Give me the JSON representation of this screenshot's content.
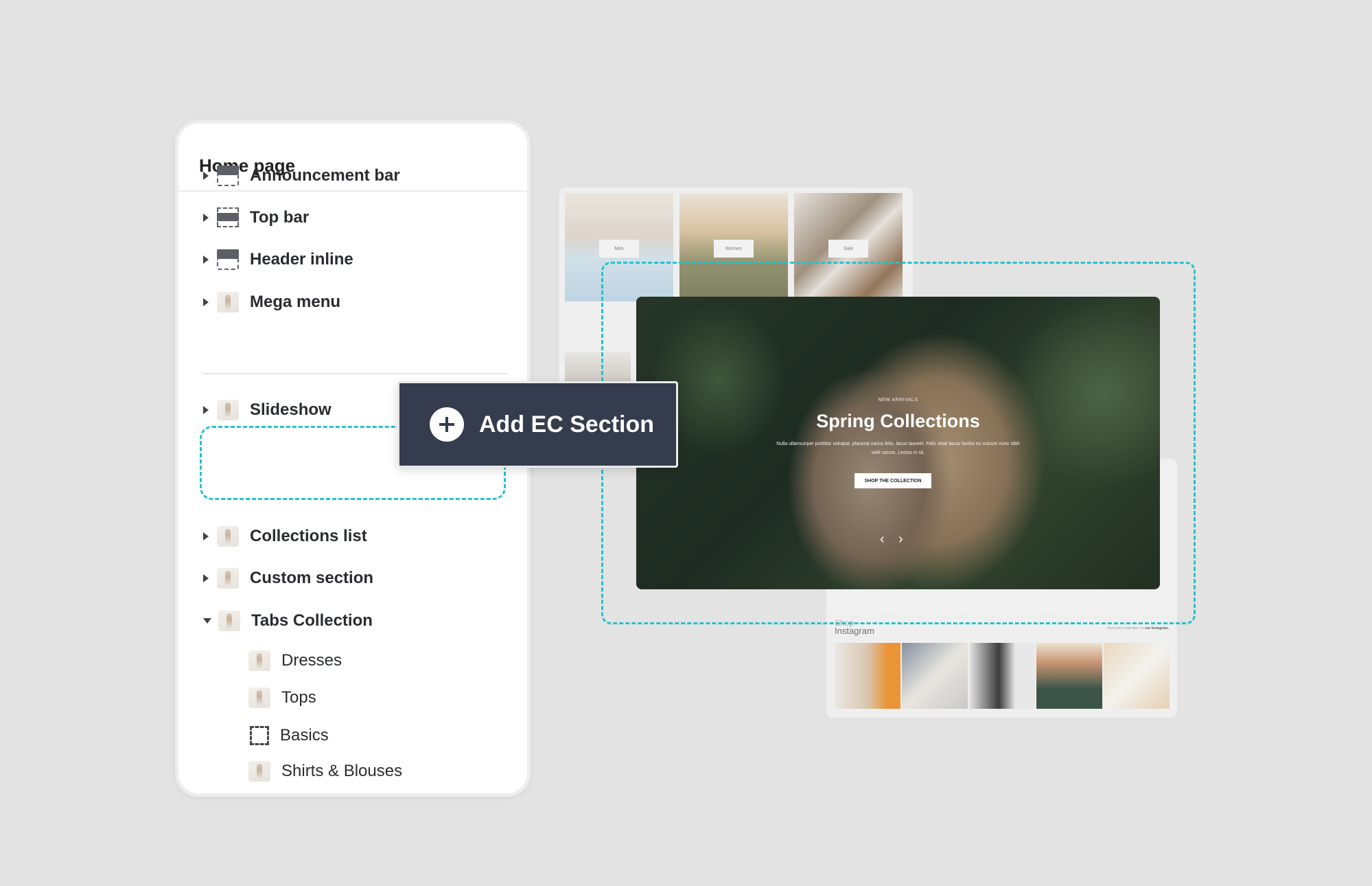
{
  "panel": {
    "title": "Home page",
    "items": [
      {
        "label": "Announcement bar",
        "icon": "layout-top-bar-icon"
      },
      {
        "label": "Top bar",
        "icon": "layout-middle-bar-icon"
      },
      {
        "label": "Header inline",
        "icon": "layout-top-bar-icon"
      },
      {
        "label": "Mega menu",
        "icon": "thumbnail-icon"
      },
      {
        "label": "Slideshow",
        "icon": "thumbnail-icon"
      },
      {
        "label": "Collections list",
        "icon": "thumbnail-icon"
      },
      {
        "label": "Custom section",
        "icon": "thumbnail-icon"
      },
      {
        "label": "Tabs Collection",
        "icon": "thumbnail-icon",
        "expanded": true
      }
    ],
    "subitems": [
      {
        "label": "Dresses"
      },
      {
        "label": "Tops"
      },
      {
        "label": "Basics"
      },
      {
        "label": "Shirts & Blouses"
      }
    ]
  },
  "add_button": {
    "label": "Add EC Section",
    "icon": "plus-circle-icon"
  },
  "preview": {
    "categories": [
      "Men",
      "Women",
      "Sale"
    ],
    "hero": {
      "kicker": "NEW ARRIVALS",
      "title": "Spring Collections",
      "body": "Nulla ullamcorper porttitor volutpat, placerat varius felis, lacus laoreet. Felis vitae lacus facilisi eu nutrum nunc nibh velit rutrum. Lectus in sit.",
      "cta": "SHOP THE COLLECTION"
    },
    "instagram": {
      "title_top": "Shop",
      "title": "Instagram",
      "note": "Find more inspiration on",
      "note_link": "our Instagram."
    }
  },
  "colors": {
    "accent": "#22c3cc",
    "button_bg": "#353c4e",
    "background": "#e3e3e3"
  }
}
